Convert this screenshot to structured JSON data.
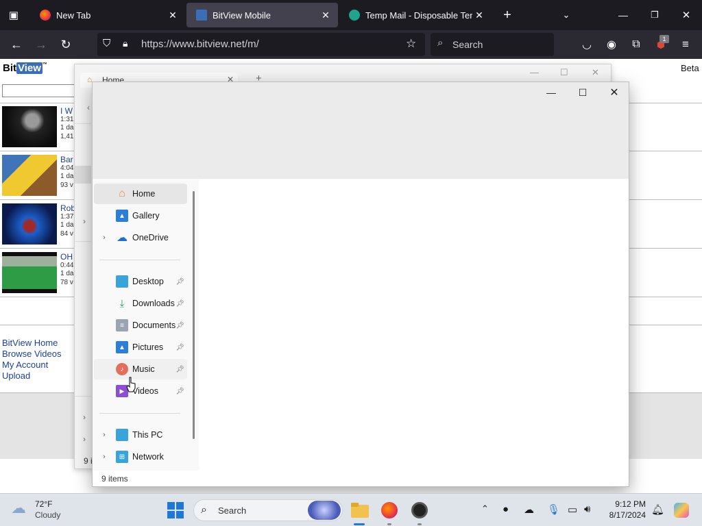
{
  "browser": {
    "tabs": [
      {
        "title": "New Tab",
        "active": false
      },
      {
        "title": "BitView Mobile",
        "active": true
      },
      {
        "title": "Temp Mail - Disposable Tempor",
        "active": false
      }
    ],
    "url": "https://www.bitview.net/m/",
    "search_placeholder": "Search",
    "extension_badge": "1"
  },
  "site": {
    "logo_bit": "Bit",
    "logo_view": "View",
    "beta": "Beta",
    "videos": [
      {
        "title": "I W",
        "line1": "1:31",
        "line2": "1 da",
        "line3": "1,41"
      },
      {
        "title": "Bar",
        "line1": "4:04",
        "line2": "1 da",
        "line3": "93 v"
      },
      {
        "title": "Rob",
        "line1": "1:37",
        "line2": "1 da",
        "line3": "84 v"
      },
      {
        "title": "OH",
        "line1": "0:44",
        "line2": "1 da",
        "line3": "78 v"
      }
    ],
    "links": [
      "BitView Home",
      "Browse Videos",
      "My Account",
      "Upload"
    ]
  },
  "bg_explorer": {
    "tab_title": "Home",
    "status_fragment": "9 i"
  },
  "explorer": {
    "nav_items": [
      {
        "label": "Home",
        "icon": "home-icon",
        "chevron": false,
        "pinned": false,
        "selected": true
      },
      {
        "label": "Gallery",
        "icon": "gallery-icon",
        "chevron": false,
        "pinned": false,
        "selected": false
      },
      {
        "label": "OneDrive",
        "icon": "cloud-icon",
        "chevron": true,
        "pinned": false,
        "selected": false
      },
      {
        "label": "Desktop",
        "icon": "desktop-icon",
        "chevron": false,
        "pinned": true,
        "selected": false
      },
      {
        "label": "Downloads",
        "icon": "download-icon",
        "chevron": false,
        "pinned": true,
        "selected": false
      },
      {
        "label": "Documents",
        "icon": "document-icon",
        "chevron": false,
        "pinned": true,
        "selected": false
      },
      {
        "label": "Pictures",
        "icon": "pictures-icon",
        "chevron": false,
        "pinned": true,
        "selected": false
      },
      {
        "label": "Music",
        "icon": "music-icon",
        "chevron": false,
        "pinned": true,
        "selected": false,
        "hovered": true
      },
      {
        "label": "Videos",
        "icon": "videos-icon",
        "chevron": false,
        "pinned": true,
        "selected": false
      },
      {
        "label": "This PC",
        "icon": "pc-icon",
        "chevron": true,
        "pinned": false,
        "selected": false
      },
      {
        "label": "Network",
        "icon": "network-icon",
        "chevron": true,
        "pinned": false,
        "selected": false
      }
    ],
    "status": "9 items"
  },
  "taskbar": {
    "weather_temp": "72°F",
    "weather_desc": "Cloudy",
    "search_label": "Search",
    "time": "9:12 PM",
    "date": "8/17/2024"
  }
}
